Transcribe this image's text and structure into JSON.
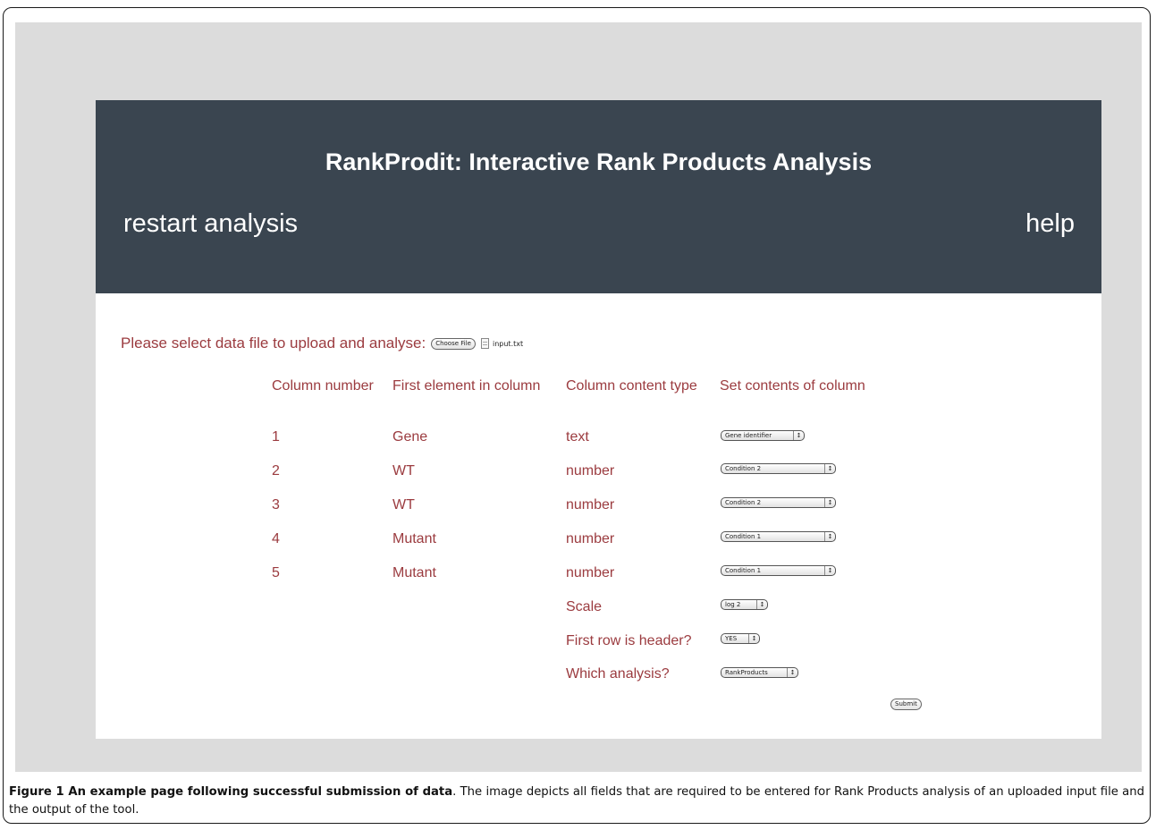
{
  "app": {
    "title": "RankProdit: Interactive Rank Products Analysis",
    "restart_label": "restart analysis",
    "help_label": "help"
  },
  "upload": {
    "prompt": "Please select data file to upload and analyse:",
    "choose_label": "Choose File",
    "file_name": "input.txt"
  },
  "table": {
    "headers": [
      "Column number",
      "First element in column",
      "Column content type",
      "Set contents of column"
    ],
    "rows": [
      {
        "number": "1",
        "first": "Gene",
        "type": "text",
        "select": "Gene identifier"
      },
      {
        "number": "2",
        "first": "WT",
        "type": "number",
        "select": "Condition 2"
      },
      {
        "number": "3",
        "first": "WT",
        "type": "number",
        "select": "Condition 2"
      },
      {
        "number": "4",
        "first": "Mutant",
        "type": "number",
        "select": "Condition 1"
      },
      {
        "number": "5",
        "first": "Mutant",
        "type": "number",
        "select": "Condition 1"
      }
    ]
  },
  "options": [
    {
      "label": "Scale",
      "value": "log 2"
    },
    {
      "label": "First row is header?",
      "value": "YES"
    },
    {
      "label": "Which analysis?",
      "value": "RankProducts"
    }
  ],
  "submit_label": "Submit",
  "select_arrows_icon": "updown-arrows-icon",
  "colors": {
    "header_bg": "#3a4550",
    "text_accent": "#9b3b3f",
    "backdrop": "#dcdcdc"
  },
  "caption": {
    "bold": "Figure 1 An example page following successful submission of data",
    "text": ". The image depicts all fields that are required to be entered for Rank Products analysis of an uploaded input file and the output of the tool."
  }
}
